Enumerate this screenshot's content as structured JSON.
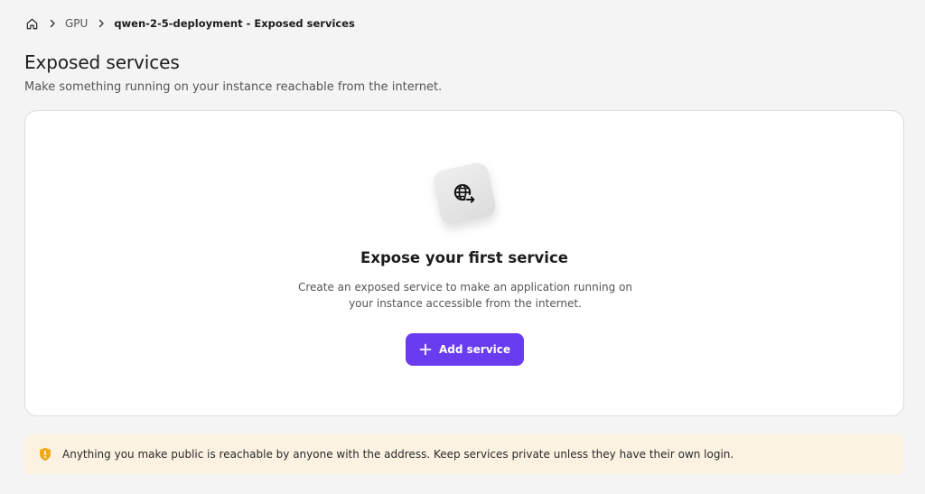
{
  "breadcrumb": {
    "home_icon": "home-icon",
    "items": [
      "GPU",
      "qwen-2-5-deployment - Exposed services"
    ]
  },
  "header": {
    "title": "Exposed services",
    "subtitle": "Make something running on your instance reachable from the internet."
  },
  "empty_state": {
    "icon": "globe-arrow-icon",
    "title": "Expose your first service",
    "description": "Create an exposed service to make an application running on your instance accessible from the internet.",
    "button_label": "Add service"
  },
  "banner": {
    "icon": "shield-warning-icon",
    "text": "Anything you make public is reachable by anyone with the address. Keep services private unless they have their own login."
  },
  "colors": {
    "accent": "#6a3cf0",
    "banner_bg": "#fbf2e1",
    "warning": "#f0a81c",
    "page_bg": "#f4f4f4"
  }
}
